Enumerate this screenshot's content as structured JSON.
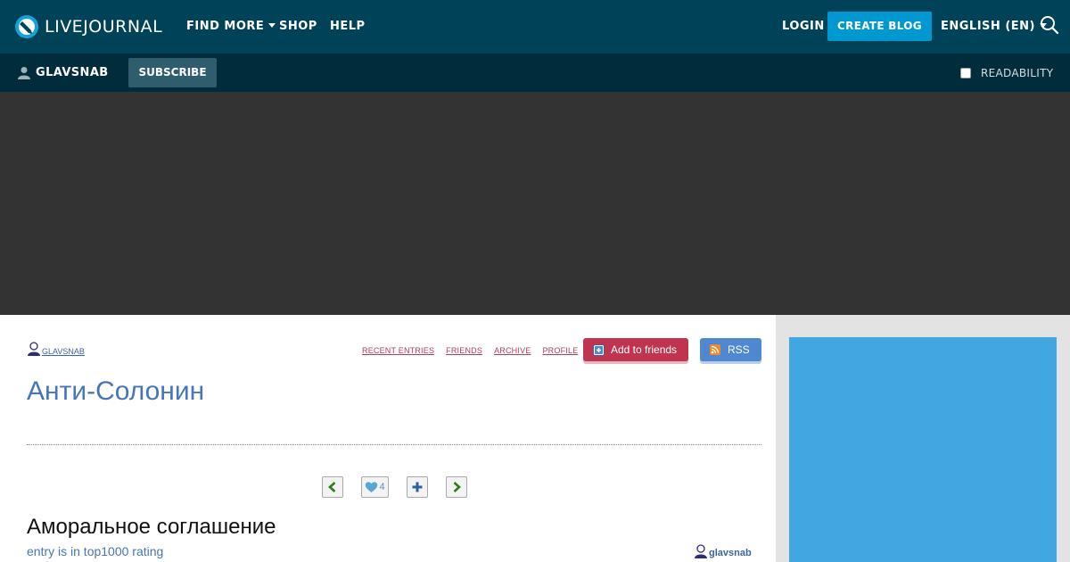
{
  "topbar": {
    "logo_text": "LIVEJOURNAL",
    "nav": [
      {
        "label": "FIND MORE",
        "dropdown": true
      },
      {
        "label": "SHOP"
      },
      {
        "label": "HELP"
      }
    ],
    "login_label": "LOGIN",
    "create_blog_label": "CREATE BLOG",
    "language_label": "ENGLISH (EN)",
    "search_icon": "search-icon",
    "bg_color": "#004359",
    "accent_color": "#0098d0"
  },
  "subbar": {
    "username": "GLAVSNAB",
    "subscribe_label": "SUBSCRIBE",
    "readability_label": "READABILITY",
    "readability_checked": false
  },
  "journal": {
    "user_link": "glavsnab",
    "menu": [
      "RECENT ENTRIES",
      "FRIENDS",
      "ARCHIVE",
      "PROFILE"
    ],
    "add_friends_label": "Add to friends",
    "rss_label": "RSS",
    "title": "Анти-Солонин"
  },
  "entry": {
    "like_count": "4",
    "title": "Аморальное соглашение",
    "subtitle": "entry is in top1000 rating",
    "author": "glavsnab"
  }
}
